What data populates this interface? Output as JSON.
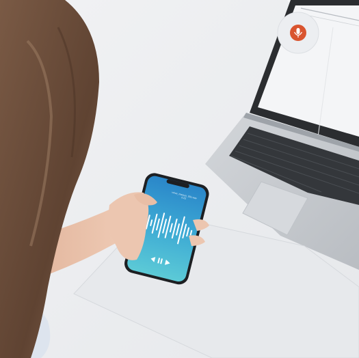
{
  "photo": {
    "subject": "woman recording voice on a smartphone next to a laptop",
    "colors": {
      "desk": "#f3f4f6",
      "wall": "#eceef1",
      "hair": "#6e4f3c",
      "skin": "#ecc6b0",
      "sleeve": "#dfe6ef",
      "laptop_body": "#c9cdd2",
      "laptop_screen": "#f4f5f7",
      "phone_gradient_top": "#2c8fcf",
      "phone_gradient_bottom": "#58c8d4",
      "mic_button": "#d9542f",
      "paper": "#e9ebee"
    }
  },
  "phone": {
    "status_lines": [
      "voice_memos_001.wav",
      "0:22"
    ]
  },
  "icons": {
    "mic": "microphone-icon",
    "rewind": "rewind-icon",
    "pause": "pause-icon",
    "play": "play-icon"
  }
}
